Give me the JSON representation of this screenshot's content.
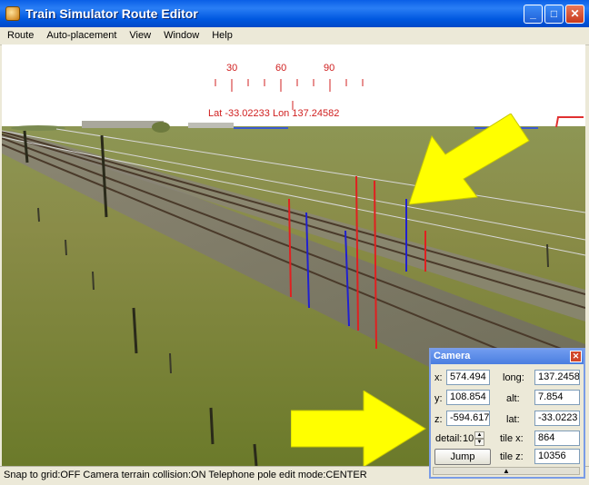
{
  "window": {
    "title": "Train Simulator Route Editor"
  },
  "menu": {
    "items": [
      "Route",
      "Auto-placement",
      "View",
      "Window",
      "Help"
    ]
  },
  "compass": {
    "ticks": [
      "30",
      "60",
      "90"
    ],
    "readout": "Lat -33.02233 Lon 137.24582"
  },
  "status": {
    "text": "Snap to grid:OFF Camera terrain collision:ON Telephone pole edit mode:CENTER"
  },
  "camera": {
    "title": "Camera",
    "x_label": "x:",
    "x_value": "574.494",
    "y_label": "y:",
    "y_value": "108.854",
    "z_label": "z:",
    "z_value": "-594.617",
    "long_label": "long:",
    "long_value": "137.2458",
    "alt_label": "alt:",
    "alt_value": "7.854",
    "lat_label": "lat:",
    "lat_value": "-33.0223",
    "detail_label": "detail:",
    "detail_value": "10",
    "tilex_label": "tile x:",
    "tilex_value": "864",
    "tilez_label": "tile z:",
    "tilez_value": "10356",
    "jump_label": "Jump"
  },
  "colors": {
    "titlebar": "#0a5fe6",
    "annotation_arrow": "#ffff00",
    "grass": "#7e8a3a",
    "sky": "#ffffff"
  }
}
